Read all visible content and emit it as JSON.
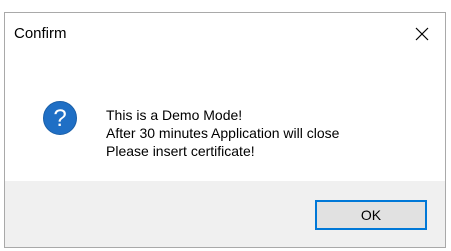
{
  "dialog": {
    "title": "Confirm",
    "close_label": "close",
    "icon": "question-icon",
    "icon_glyph": "?",
    "icon_color": "#1f6fc5",
    "message_lines": [
      "This is a Demo Mode!",
      "After 30 minutes Application will close",
      "Please insert certificate!"
    ],
    "ok_label": "OK",
    "accent_color": "#0078d7",
    "footer_color": "#f0f0f0"
  }
}
